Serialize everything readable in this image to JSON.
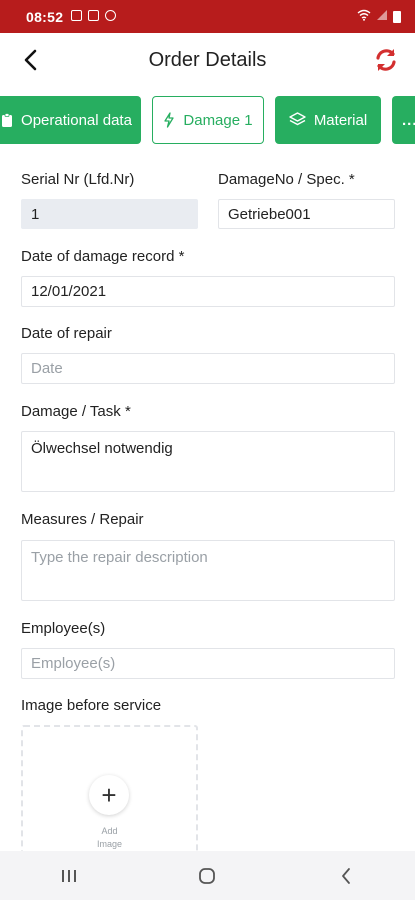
{
  "status_bar": {
    "time": "08:52"
  },
  "header": {
    "title": "Order Details"
  },
  "tabs": [
    {
      "label": "Operational data"
    },
    {
      "label": "Damage 1"
    },
    {
      "label": "Material"
    },
    {
      "label": "..."
    }
  ],
  "form": {
    "serial_label": "Serial Nr (Lfd.Nr)",
    "serial_value": "1",
    "damageno_label": "DamageNo / Spec. *",
    "damageno_value": "Getriebe001",
    "date_record_label": "Date of damage record *",
    "date_record_value": "12/01/2021",
    "date_repair_label": "Date of repair",
    "date_repair_placeholder": "Date",
    "damage_task_label": "Damage / Task *",
    "damage_task_value": "Ölwechsel notwendig",
    "measures_label": "Measures / Repair",
    "measures_placeholder": "Type the repair description",
    "employees_label": "Employee(s)",
    "employees_placeholder": "Employee(s)",
    "image_before_label": "Image before service",
    "add_image_line1": "Add",
    "add_image_line2": "Image"
  },
  "colors": {
    "status_bar": "#b71c1c",
    "accent_green": "#27ae60",
    "refresh_red": "#d32f2f"
  },
  "icons": [
    "back-arrow-icon",
    "refresh-icon",
    "clipboard-icon",
    "bolt-icon",
    "layers-icon",
    "more-icon",
    "plus-icon",
    "recent-apps-icon",
    "home-icon",
    "back-nav-icon"
  ]
}
